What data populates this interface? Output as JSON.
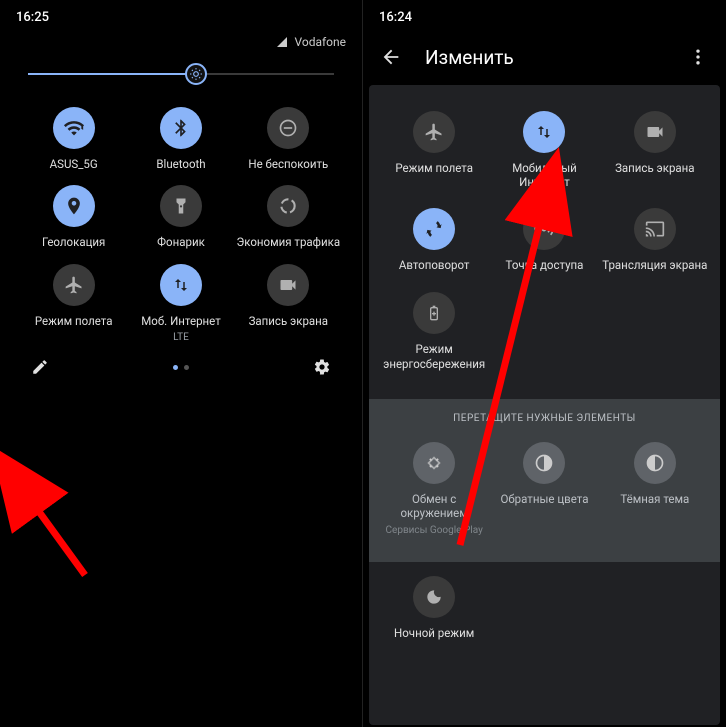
{
  "left": {
    "time": "16:25",
    "carrier": "Vodafone",
    "brightness_pct": 55,
    "tiles": [
      {
        "id": "wifi",
        "label": "ASUS_5G",
        "sublabel": "",
        "active": true,
        "icon": "wifi"
      },
      {
        "id": "bluetooth",
        "label": "Bluetooth",
        "sublabel": "",
        "active": true,
        "icon": "bluetooth"
      },
      {
        "id": "dnd",
        "label": "Не беспокоить",
        "sublabel": "",
        "active": false,
        "icon": "dnd"
      },
      {
        "id": "location",
        "label": "Геолокация",
        "sublabel": "",
        "active": true,
        "icon": "location"
      },
      {
        "id": "flashlight",
        "label": "Фонарик",
        "sublabel": "",
        "active": false,
        "icon": "flashlight"
      },
      {
        "id": "datasaver",
        "label": "Экономия трафика",
        "sublabel": "",
        "active": false,
        "icon": "datasaver"
      },
      {
        "id": "airplane",
        "label": "Режим полета",
        "sublabel": "",
        "active": false,
        "icon": "airplane"
      },
      {
        "id": "mobiledata",
        "label": "Моб. Интернет",
        "sublabel": "LTE",
        "active": true,
        "icon": "mobiledata"
      },
      {
        "id": "screenrecord",
        "label": "Запись экрана",
        "sublabel": "",
        "active": false,
        "icon": "screenrecord"
      }
    ],
    "page_current": 1,
    "page_total": 2
  },
  "right": {
    "time": "16:24",
    "title": "Изменить",
    "tiles_top": [
      {
        "id": "airplane",
        "label": "Режим полета",
        "active": false,
        "icon": "airplane"
      },
      {
        "id": "mobiledata",
        "label": "Мобильный Интернет",
        "active": true,
        "icon": "mobiledata"
      },
      {
        "id": "screenrecord",
        "label": "Запись экрана",
        "active": false,
        "icon": "screenrecord"
      },
      {
        "id": "autorotate",
        "label": "Автоповорот",
        "active": true,
        "icon": "autorotate"
      },
      {
        "id": "hotspot",
        "label": "Точка доступа",
        "active": false,
        "icon": "hotspot"
      },
      {
        "id": "cast",
        "label": "Трансляция экрана",
        "active": false,
        "icon": "cast"
      }
    ],
    "tiles_mid": [
      {
        "id": "battery",
        "label": "Режим энергосбережения",
        "active": false,
        "icon": "battery"
      }
    ],
    "drag_hint": "ПЕРЕТАЩИТЕ НУЖНЫЕ ЭЛЕМЕНТЫ",
    "inactive_tiles": [
      {
        "id": "nearby",
        "label": "Обмен с окружением",
        "sublabel": "Сервисы Google Play",
        "icon": "nearby"
      },
      {
        "id": "invert",
        "label": "Обратные цвета",
        "sublabel": "",
        "icon": "invert"
      },
      {
        "id": "darktheme",
        "label": "Тёмная тема",
        "sublabel": "",
        "icon": "darktheme",
        "active": true
      }
    ],
    "bottom_tile": {
      "id": "nightmode",
      "label": "Ночной режим",
      "icon": "nightmode"
    }
  },
  "colors": {
    "accent": "#8ab4f8",
    "bg_panel": "#202124",
    "tile_inactive": "#3a3a3a"
  }
}
